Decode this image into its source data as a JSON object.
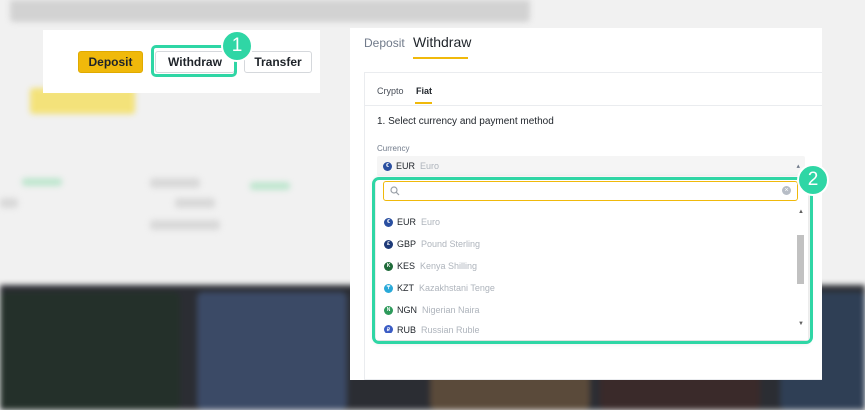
{
  "header": {
    "deposit_label": "Deposit",
    "withdraw_label": "Withdraw",
    "transfer_label": "Transfer"
  },
  "steps": {
    "one": "1",
    "two": "2"
  },
  "panel": {
    "tabs": {
      "deposit": "Deposit",
      "withdraw": "Withdraw"
    },
    "subtabs": {
      "crypto": "Crypto",
      "fiat": "Fiat"
    },
    "section_title": "1. Select currency and payment method",
    "currency_label": "Currency",
    "selected": {
      "code": "EUR",
      "name": "Euro",
      "icon": "euro-coin-icon"
    }
  },
  "dropdown": {
    "search_placeholder": "",
    "options": [
      {
        "code": "EUR",
        "name": "Euro",
        "color": "#2a4fa0",
        "glyph": "€",
        "icon": "euro-coin-icon"
      },
      {
        "code": "GBP",
        "name": "Pound Sterling",
        "color": "#1e3a78",
        "glyph": "£",
        "icon": "pound-coin-icon"
      },
      {
        "code": "KES",
        "name": "Kenya Shilling",
        "color": "#1f6b3a",
        "glyph": "K",
        "icon": "kes-coin-icon"
      },
      {
        "code": "KZT",
        "name": "Kazakhstani Tenge",
        "color": "#29a9d8",
        "glyph": "₸",
        "icon": "kzt-coin-icon"
      },
      {
        "code": "NGN",
        "name": "Nigerian Naira",
        "color": "#2e9a5b",
        "glyph": "N",
        "icon": "ngn-coin-icon"
      },
      {
        "code": "RUB",
        "name": "Russian Ruble",
        "color": "#3b5cc4",
        "glyph": "₽",
        "icon": "rub-coin-icon"
      }
    ]
  },
  "colors": {
    "accent": "#f0b90b",
    "highlight": "#2fd6a5"
  }
}
